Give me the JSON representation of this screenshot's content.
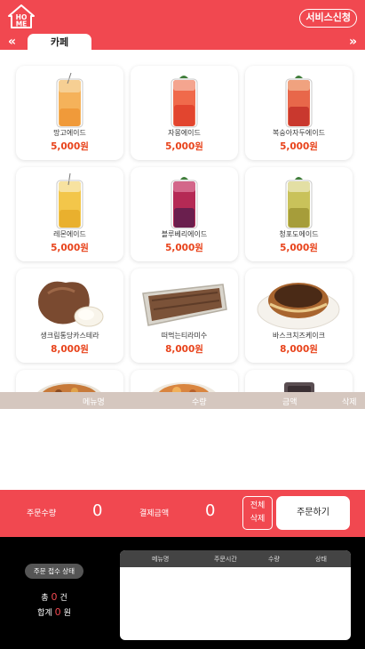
{
  "header": {
    "logo_text": "HOME",
    "service_button": "서비스신청",
    "active_tab": "카페",
    "prev_arrow": "«",
    "next_arrow": "»"
  },
  "menu_items": [
    {
      "name": "망고에이드",
      "price": "5,000원",
      "icon": "mango-ade-drink"
    },
    {
      "name": "자몽에이드",
      "price": "5,000원",
      "icon": "grapefruit-ade-drink"
    },
    {
      "name": "복숭아자두에이드",
      "price": "5,000원",
      "icon": "peach-plum-ade-drink"
    },
    {
      "name": "레몬에이드",
      "price": "5,000원",
      "icon": "lemon-ade-drink"
    },
    {
      "name": "블루베리에이드",
      "price": "5,000원",
      "icon": "blueberry-ade-drink"
    },
    {
      "name": "청포도에이드",
      "price": "5,000원",
      "icon": "green-grape-ade-drink"
    },
    {
      "name": "생크림통당카스테라",
      "price": "8,000원",
      "icon": "cream-castella-cake"
    },
    {
      "name": "떠먹는티라미수",
      "price": "8,000원",
      "icon": "tiramisu-tray"
    },
    {
      "name": "바스크치즈케이크",
      "price": "8,000원",
      "icon": "basque-cheesecake"
    }
  ],
  "order_list_header": {
    "menu": "메뉴명",
    "qty": "수량",
    "amount": "금액",
    "delete": "삭제"
  },
  "summary": {
    "qty_label": "주문수량",
    "qty_value": "0",
    "amount_label": "결제금액",
    "amount_value": "0",
    "clear_line1": "전체",
    "clear_line2": "삭제",
    "order_button": "주문하기"
  },
  "bottom": {
    "status_badge": "주문 접수 상태",
    "count_prefix": "총",
    "count_value": "0",
    "count_unit": "건",
    "sum_prefix": "합계",
    "sum_value": "0",
    "sum_unit": "원",
    "history_headers": {
      "menu": "메뉴명",
      "time": "주문시간",
      "qty": "수량",
      "status": "상태"
    }
  },
  "colors": {
    "brand_red": "#f14850",
    "price_orange": "#e8431b",
    "list_header_beige": "#d5c7bf"
  }
}
